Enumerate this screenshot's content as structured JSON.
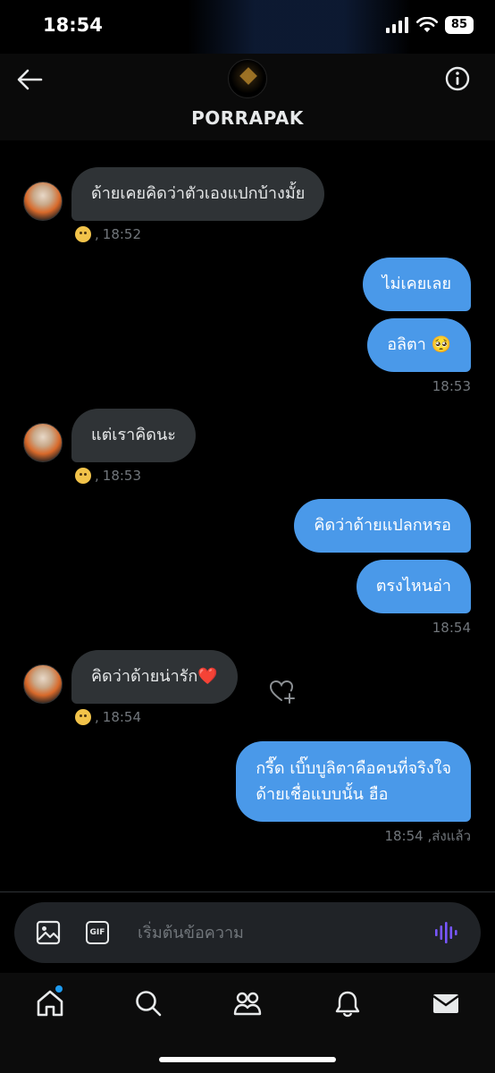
{
  "status_bar": {
    "time": "18:54",
    "battery": "85"
  },
  "header": {
    "name": "PORRAPAK"
  },
  "messages": [
    {
      "dir": "in",
      "text": "ด้ายเคยคิดว่าตัวเองแปกบ้างมั้ย",
      "time": "18:52"
    },
    {
      "dir": "out",
      "text": "ไม่เคยเลย"
    },
    {
      "dir": "out",
      "text": "อลิตา 🥺",
      "time": "18:53"
    },
    {
      "dir": "in",
      "text": "แต่เราคิดนะ",
      "time": "18:53"
    },
    {
      "dir": "out",
      "text": "คิดว่าด้ายแปลกหรอ"
    },
    {
      "dir": "out",
      "text": "ตรงไหนอ่า",
      "time": "18:54"
    },
    {
      "dir": "in",
      "text": "คิดว่าด้ายน่ารัก❤️",
      "time": "18:54"
    },
    {
      "dir": "out",
      "line1": "กรี๊ด เบิ๊บบูลิตาคือคนที่จริงใจ",
      "line2": "ด้ายเชื่อแบบนั้น ฮือ",
      "time_status": "18:54 ,ส่งแล้ว"
    }
  ],
  "reaction_prefix": ",",
  "composer": {
    "placeholder": "เริ่มต้นข้อความ",
    "gif_label": "GIF"
  },
  "colors": {
    "outgoing_bubble": "#4a99e9",
    "incoming_bubble": "#2f3336",
    "voice_icon": "#7856ff",
    "notif_dot": "#1d9bf0"
  },
  "nav": [
    "home-icon",
    "search-icon",
    "communities-icon",
    "bell-icon",
    "mail-icon"
  ]
}
